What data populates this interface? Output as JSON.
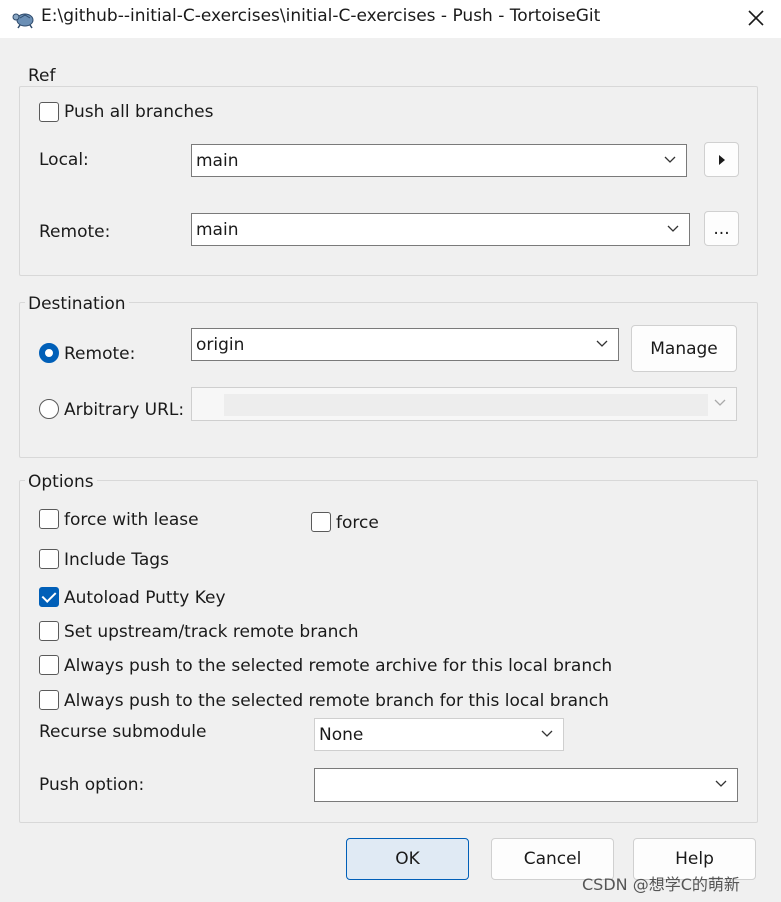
{
  "window": {
    "title": "E:\\github--initial-C-exercises\\initial-C-exercises - Push - TortoiseGit"
  },
  "ref": {
    "group_label": "Ref",
    "push_all_branches": {
      "label": "Push all branches",
      "checked": false
    },
    "local_label": "Local:",
    "local_value": "main",
    "local_arrow_icon": "play-right-icon",
    "remote_label": "Remote:",
    "remote_value": "main",
    "remote_browse_label": "..."
  },
  "destination": {
    "group_label": "Destination",
    "remote_radio_label": "Remote:",
    "remote_value": "origin",
    "manage_label": "Manage",
    "arbitrary_url_label": "Arbitrary URL:",
    "arbitrary_url_value": "",
    "selected": "remote"
  },
  "options": {
    "group_label": "Options",
    "force_with_lease": {
      "label": "force with lease",
      "checked": false
    },
    "force": {
      "label": "force",
      "checked": false
    },
    "include_tags": {
      "label": "Include Tags",
      "checked": false
    },
    "autoload_putty_key": {
      "label": "Autoload Putty Key",
      "checked": true
    },
    "set_upstream": {
      "label": "Set upstream/track remote branch",
      "checked": false
    },
    "always_push_archive": {
      "label": "Always push to the selected remote archive for this local branch",
      "checked": false
    },
    "always_push_branch": {
      "label": "Always push to the selected remote branch for this local branch",
      "checked": false
    },
    "recurse_submodule_label": "Recurse submodule",
    "recurse_submodule_value": "None",
    "push_option_label": "Push option:",
    "push_option_value": ""
  },
  "buttons": {
    "ok": "OK",
    "cancel": "Cancel",
    "help": "Help"
  },
  "watermark": "CSDN @想学C的萌新",
  "colors": {
    "accent": "#005fb8",
    "background": "#f0f0f0"
  }
}
